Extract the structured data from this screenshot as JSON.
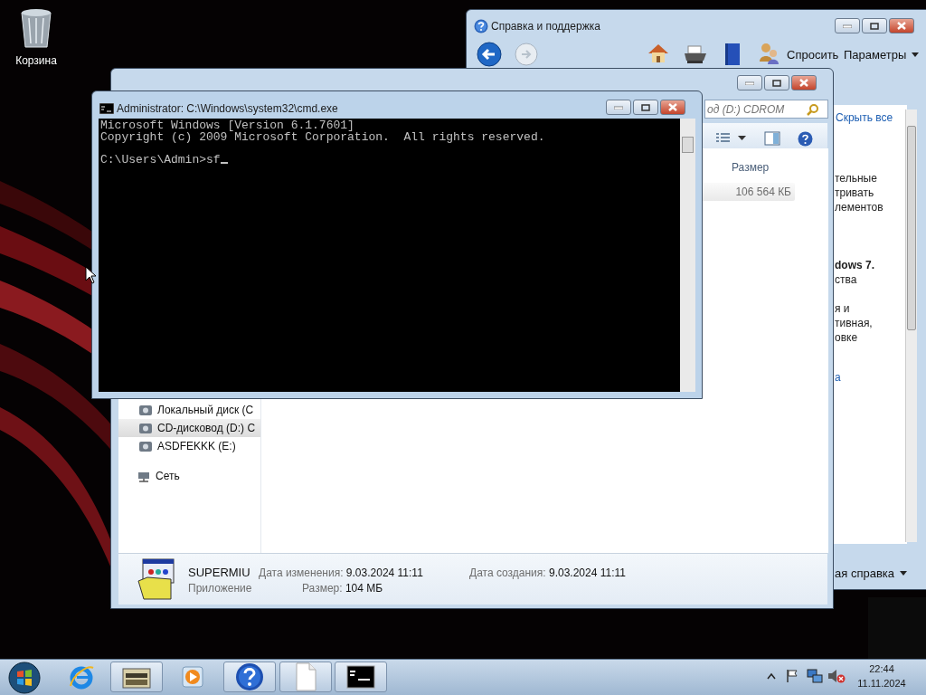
{
  "desktop_icons": [
    {
      "label": "Корзина"
    }
  ],
  "help_window": {
    "title": "Справка и поддержка",
    "ask": "Спросить",
    "options": "Параметры",
    "hide_all": "Скрыть все",
    "text_fragments": [
      {
        "text": "тельные",
        "bold": false
      },
      {
        "text": "тривать",
        "bold": false
      },
      {
        "text": "лементов",
        "bold": false
      },
      {
        "text": "dows 7.",
        "bold": true
      },
      {
        "text": "ства",
        "bold": false
      },
      {
        "text": "я и",
        "bold": false
      },
      {
        "text": "тивная,",
        "bold": false
      },
      {
        "text": "овке",
        "bold": false
      },
      {
        "text": "а",
        "bold": false,
        "kind": "link"
      }
    ],
    "footer": "ая справка"
  },
  "explorer_window": {
    "search": {
      "placeholder": "од (D:) CDROM"
    },
    "columns": [
      "Размер"
    ],
    "rows": [
      {
        "size": "106 564 КБ"
      }
    ],
    "nav_items": [
      {
        "label": "Локальный диск (C",
        "selected": false
      },
      {
        "label": "CD-дисковод (D:) C",
        "selected": true
      },
      {
        "label": "ASDFEKKK (E:)",
        "selected": false
      }
    ],
    "network": "Сеть",
    "details": {
      "name": "SUPERMIU",
      "type": "Приложение",
      "fields": [
        {
          "label": "Дата изменения:",
          "value": "9.03.2024 11:11"
        },
        {
          "label": "Размер:",
          "value": "104 МБ"
        },
        {
          "label": "Дата создания:",
          "value": "9.03.2024 11:11"
        }
      ]
    }
  },
  "cmd_window": {
    "title": "Administrator: C:\\Windows\\system32\\cmd.exe",
    "output_lines": [
      "Microsoft Windows [Version 6.1.7601]",
      "Copyright (c) 2009 Microsoft Corporation.  All rights reserved."
    ],
    "prompt": "C:\\Users\\Admin>sf"
  },
  "taskbar": {
    "buttons": [
      {
        "kind": "ie",
        "running": false
      },
      {
        "kind": "explorer",
        "running": true
      },
      {
        "kind": "media",
        "running": false
      },
      {
        "kind": "help",
        "running": true
      },
      {
        "kind": "document",
        "running": true
      },
      {
        "kind": "cmd",
        "running": true
      }
    ],
    "time": "22:44",
    "date": "11.11.2024"
  }
}
